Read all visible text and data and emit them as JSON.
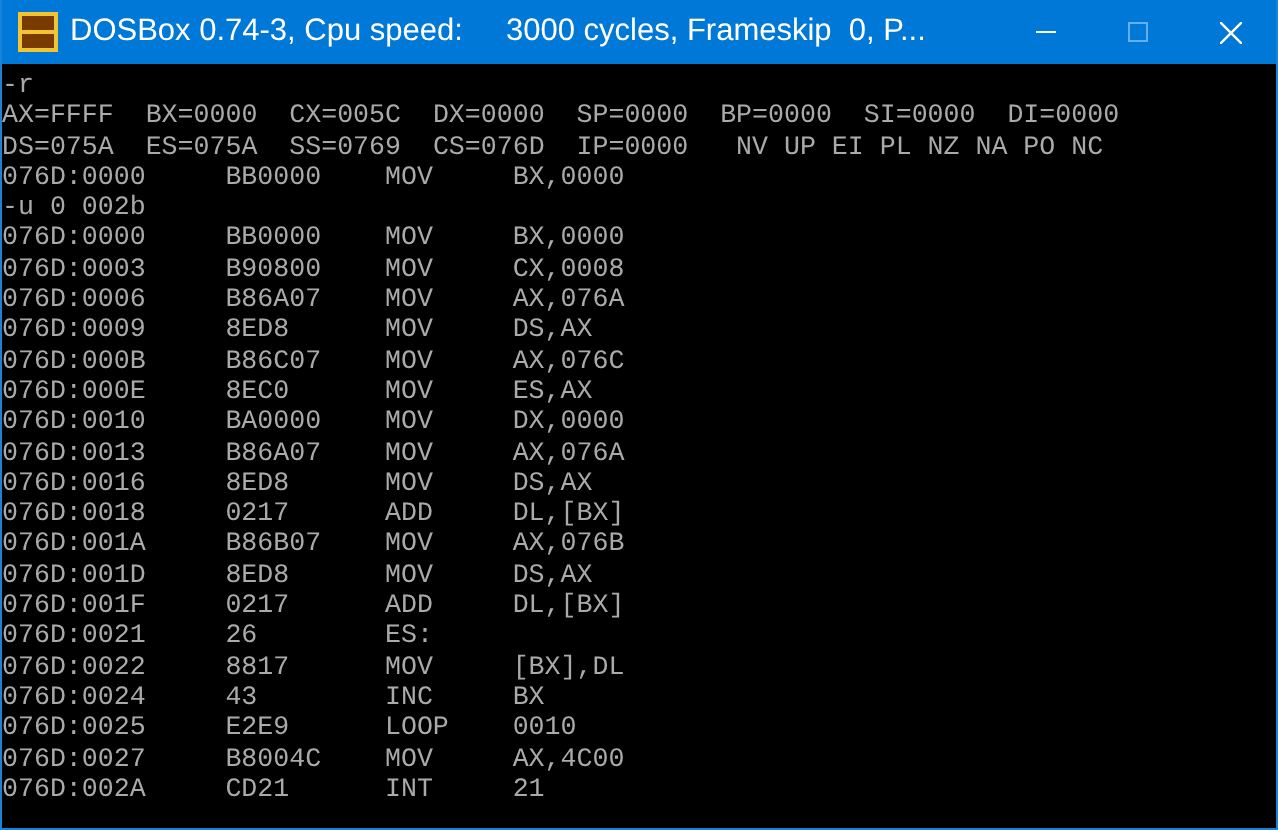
{
  "window": {
    "title": "DOSBox 0.74-3, Cpu speed:     3000 cycles, Frameskip  0, P...",
    "controls": [
      {
        "kind": "minimize",
        "disabled": false
      },
      {
        "kind": "maximize",
        "disabled": true
      },
      {
        "kind": "close",
        "disabled": false
      }
    ]
  },
  "console": {
    "lines": [
      {
        "kind": "text",
        "text": "-r"
      },
      {
        "kind": "text",
        "text": "AX=FFFF  BX=0000  CX=005C  DX=0000  SP=0000  BP=0000  SI=0000  DI=0000"
      },
      {
        "kind": "text",
        "text": "DS=075A  ES=075A  SS=0769  CS=076D  IP=0000   NV UP EI PL NZ NA PO NC"
      },
      {
        "kind": "disasm",
        "address": "076D:0000",
        "bytes": "BB0000",
        "mnemonic": "MOV",
        "operands": "BX,0000"
      },
      {
        "kind": "text",
        "text": "-u 0 002b"
      },
      {
        "kind": "disasm",
        "address": "076D:0000",
        "bytes": "BB0000",
        "mnemonic": "MOV",
        "operands": "BX,0000"
      },
      {
        "kind": "disasm",
        "address": "076D:0003",
        "bytes": "B90800",
        "mnemonic": "MOV",
        "operands": "CX,0008"
      },
      {
        "kind": "disasm",
        "address": "076D:0006",
        "bytes": "B86A07",
        "mnemonic": "MOV",
        "operands": "AX,076A"
      },
      {
        "kind": "disasm",
        "address": "076D:0009",
        "bytes": "8ED8",
        "mnemonic": "MOV",
        "operands": "DS,AX"
      },
      {
        "kind": "disasm",
        "address": "076D:000B",
        "bytes": "B86C07",
        "mnemonic": "MOV",
        "operands": "AX,076C"
      },
      {
        "kind": "disasm",
        "address": "076D:000E",
        "bytes": "8EC0",
        "mnemonic": "MOV",
        "operands": "ES,AX"
      },
      {
        "kind": "disasm",
        "address": "076D:0010",
        "bytes": "BA0000",
        "mnemonic": "MOV",
        "operands": "DX,0000"
      },
      {
        "kind": "disasm",
        "address": "076D:0013",
        "bytes": "B86A07",
        "mnemonic": "MOV",
        "operands": "AX,076A"
      },
      {
        "kind": "disasm",
        "address": "076D:0016",
        "bytes": "8ED8",
        "mnemonic": "MOV",
        "operands": "DS,AX"
      },
      {
        "kind": "disasm",
        "address": "076D:0018",
        "bytes": "0217",
        "mnemonic": "ADD",
        "operands": "DL,[BX]"
      },
      {
        "kind": "disasm",
        "address": "076D:001A",
        "bytes": "B86B07",
        "mnemonic": "MOV",
        "operands": "AX,076B"
      },
      {
        "kind": "disasm",
        "address": "076D:001D",
        "bytes": "8ED8",
        "mnemonic": "MOV",
        "operands": "DS,AX"
      },
      {
        "kind": "disasm",
        "address": "076D:001F",
        "bytes": "0217",
        "mnemonic": "ADD",
        "operands": "DL,[BX]"
      },
      {
        "kind": "disasm",
        "address": "076D:0021",
        "bytes": "26",
        "mnemonic": "ES:"
      },
      {
        "kind": "disasm",
        "address": "076D:0022",
        "bytes": "8817",
        "mnemonic": "MOV",
        "operands": "[BX],DL"
      },
      {
        "kind": "disasm",
        "address": "076D:0024",
        "bytes": "43",
        "mnemonic": "INC",
        "operands": "BX"
      },
      {
        "kind": "disasm",
        "address": "076D:0025",
        "bytes": "E2E9",
        "mnemonic": "LOOP",
        "operands": "0010"
      },
      {
        "kind": "disasm",
        "address": "076D:0027",
        "bytes": "B8004C",
        "mnemonic": "MOV",
        "operands": "AX,4C00"
      },
      {
        "kind": "disasm",
        "address": "076D:002A",
        "bytes": "CD21",
        "mnemonic": "INT",
        "operands": "21"
      }
    ]
  }
}
